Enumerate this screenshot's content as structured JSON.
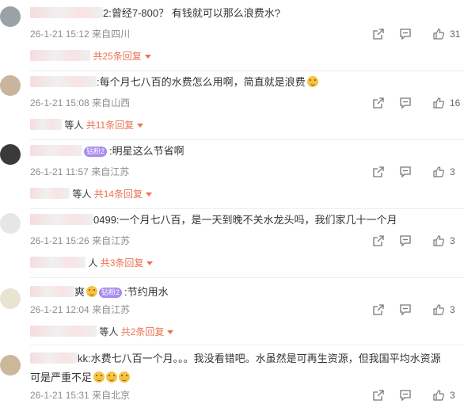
{
  "comments": [
    {
      "user_suffix": "2",
      "text": ":曾经7-800？ 有钱就可以那么浪费水?",
      "time": "26-1-21 15:12",
      "location": "来自四川",
      "likes": "31",
      "replies_who": "",
      "replies_total": "共25条回复"
    },
    {
      "user_suffix": "",
      "text": ":每个月七八百的水费怎么用啊，简直就是浪费",
      "time": "26-1-21 15:08",
      "location": "来自山西",
      "likes": "16",
      "replies_who": "等人",
      "replies_total": "共11条回复"
    },
    {
      "user_suffix": "",
      "badge": "钻粉2",
      "text": ":明星这么节省啊",
      "time": "26-1-21 11:57",
      "location": "来自江苏",
      "likes": "3",
      "replies_who": "等人",
      "replies_total": "共14条回复"
    },
    {
      "user_suffix": "0499",
      "text": ":一个月七八百，是一天到晚不关水龙头吗，我们家几十一个月",
      "time": "26-1-21 15:26",
      "location": "来自江苏",
      "likes": "3",
      "replies_who": "人",
      "replies_total": "共3条回复"
    },
    {
      "user_suffix": "爽",
      "badge": "钻粉2",
      "text": ":节约用水",
      "time": "26-1-21 12:04",
      "location": "来自江苏",
      "likes": "3",
      "replies_who": "等人",
      "replies_total": "共2条回复"
    },
    {
      "user_suffix": "kk",
      "text": ":水费七八百一个月。。。我没看错吧。水虽然是可再生资源，但我国平均水资源",
      "text2": "可是严重不足",
      "time": "26-1-21 15:31",
      "location": "来自北京",
      "likes": "3"
    }
  ],
  "icons": [
    "share-icon",
    "comment-icon",
    "like-icon"
  ],
  "colors": {
    "accent": "#eb7350",
    "badge": "#a88cf0",
    "meta": "#8d8d8d"
  }
}
